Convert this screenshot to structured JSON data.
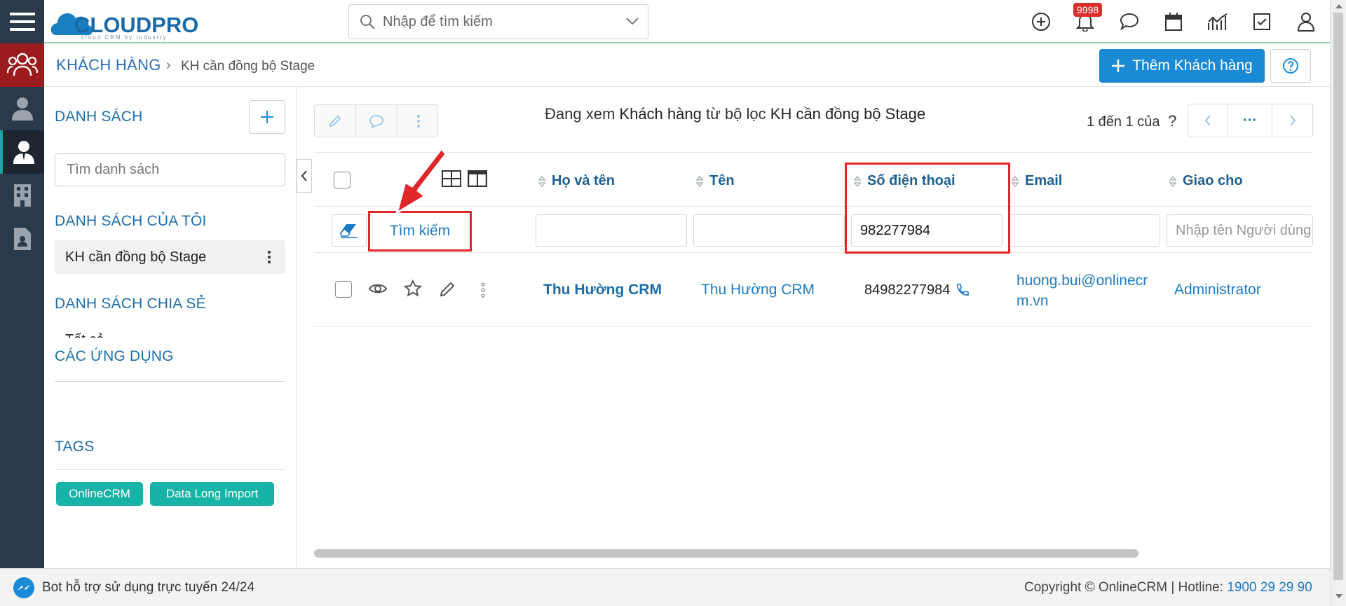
{
  "app": {
    "logo_text": "CLOUDPRO",
    "logo_tagline": "cloud CRM by industry",
    "search_placeholder": "Nhập để tìm kiếm",
    "notification_count": "9998"
  },
  "breadcrumb": {
    "module": "KHÁCH HÀNG",
    "separator": "›",
    "current": "KH cần đồng bộ Stage"
  },
  "actions": {
    "add_label": "Thêm Khách hàng"
  },
  "sidebar": {
    "lists_title": "DANH SÁCH",
    "list_search_placeholder": "Tìm danh sách",
    "my_lists_title": "DANH SÁCH CỦA TÔI",
    "my_lists": [
      {
        "label": "KH cần đồng bộ Stage"
      }
    ],
    "shared_lists_title": "DANH SÁCH CHIA SẺ",
    "shared_truncated": "Tất cả",
    "apps_title": "CÁC ỨNG DỤNG",
    "tags_title": "TAGS",
    "tags": [
      {
        "label": "OnlineCRM"
      },
      {
        "label": "Data Long Import"
      }
    ]
  },
  "main": {
    "viewing_prefix": "Đang xem",
    "viewing_module": "Khách hàng",
    "viewing_mid": "từ bộ lọc",
    "viewing_filter": "KH cần đồng bộ Stage",
    "paging": "1 đến 1 của",
    "paging_unknown": "?",
    "pager_more": "···",
    "search_button": "Tìm kiếm",
    "columns": [
      {
        "label": "Họ và tên"
      },
      {
        "label": "Tên"
      },
      {
        "label": "Số điện thoại"
      },
      {
        "label": "Email"
      },
      {
        "label": "Giao cho"
      }
    ],
    "filters": {
      "ho_va_ten": "",
      "ten": "",
      "so_dien_thoai": "982277984",
      "email": "",
      "giao_cho_placeholder": "Nhập tên Người dùng"
    },
    "rows": [
      {
        "ho_va_ten": "Thu Hường CRM",
        "ten": "Thu Hường CRM",
        "so_dien_thoai": "84982277984",
        "email_line1": "huong.bui@onlinecr",
        "email_line2": "m.vn",
        "giao_cho": "Administrator"
      }
    ]
  },
  "footer": {
    "bot_text": "Bot hỗ trợ sử dụng trực tuyến 24/24",
    "copyright": "Copyright © OnlineCRM | Hotline:",
    "hotline": "1900 29 29 90"
  },
  "colors": {
    "rail_bg": "#2b3a4a",
    "rail_active": "#9b1b1e",
    "primary": "#1a8ad6",
    "header_text": "#1d5f91",
    "link": "#1d7ac7",
    "tag_bg": "#17b3a6",
    "highlight": "#e1262a"
  },
  "icons": [
    "menu-icon",
    "people-icon",
    "user-icon",
    "business-user-icon",
    "building-icon",
    "document-user-icon",
    "search-icon",
    "chevron-down-icon",
    "plus-circle-icon",
    "bell-icon",
    "chat-icon",
    "calendar-icon",
    "chart-icon",
    "checkbox-icon",
    "account-icon",
    "plus-icon",
    "help-icon",
    "pencil-icon",
    "comment-icon",
    "kebab-icon",
    "grid-icon",
    "columns-icon",
    "sort-icon",
    "eraser-icon",
    "eye-icon",
    "star-icon",
    "phone-icon",
    "messenger-icon",
    "arrow-annotation"
  ]
}
